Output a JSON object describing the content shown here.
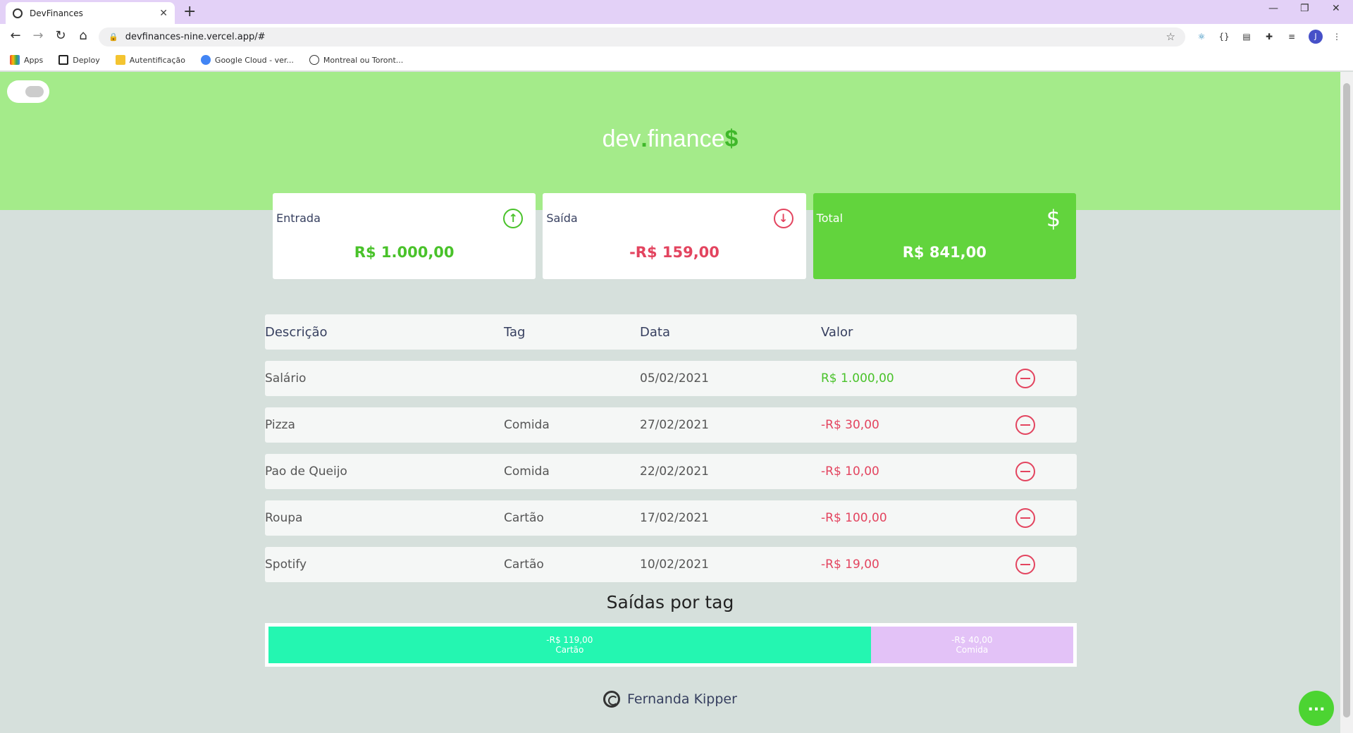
{
  "browser": {
    "tab_title": "DevFinances",
    "url": "devfinances-nine.vercel.app/#",
    "bookmarks": [
      "Apps",
      "Deploy",
      "Autentificação",
      "Google Cloud - ver...",
      "Montreal ou Toront..."
    ],
    "profile_initial": "J"
  },
  "header": {
    "logo_dev": "dev",
    "logo_dot": ".",
    "logo_finance": "finance",
    "logo_dollar": "$"
  },
  "cards": {
    "income": {
      "label": "Entrada",
      "amount": "R$ 1.000,00",
      "icon": "↑"
    },
    "expense": {
      "label": "Saída",
      "amount": "-R$ 159,00",
      "icon": "↓"
    },
    "total": {
      "label": "Total",
      "amount": "R$ 841,00",
      "icon": "$"
    }
  },
  "table": {
    "headers": [
      "Descrição",
      "Tag",
      "Data",
      "Valor"
    ],
    "rows": [
      {
        "desc": "Salário",
        "tag": "",
        "date": "05/02/2021",
        "value": "R$ 1.000,00",
        "type": "income"
      },
      {
        "desc": "Pizza",
        "tag": "Comida",
        "date": "27/02/2021",
        "value": "-R$ 30,00",
        "type": "expense"
      },
      {
        "desc": "Pao de Queijo",
        "tag": "Comida",
        "date": "22/02/2021",
        "value": "-R$ 10,00",
        "type": "expense"
      },
      {
        "desc": "Roupa",
        "tag": "Cartão",
        "date": "17/02/2021",
        "value": "-R$ 100,00",
        "type": "expense"
      },
      {
        "desc": "Spotify",
        "tag": "Cartão",
        "date": "10/02/2021",
        "value": "-R$ 19,00",
        "type": "expense"
      }
    ]
  },
  "tag_chart": {
    "title": "Saídas por tag",
    "segments": [
      {
        "amount": "-R$ 119,00",
        "tag": "Cartão",
        "value": 119,
        "color": "#24f6b1"
      },
      {
        "amount": "-R$ 40,00",
        "tag": "Comida",
        "value": 40,
        "color": "#e3c2f7"
      }
    ]
  },
  "footer": {
    "author": "Fernanda Kipper"
  },
  "fab": {
    "label": "..."
  }
}
